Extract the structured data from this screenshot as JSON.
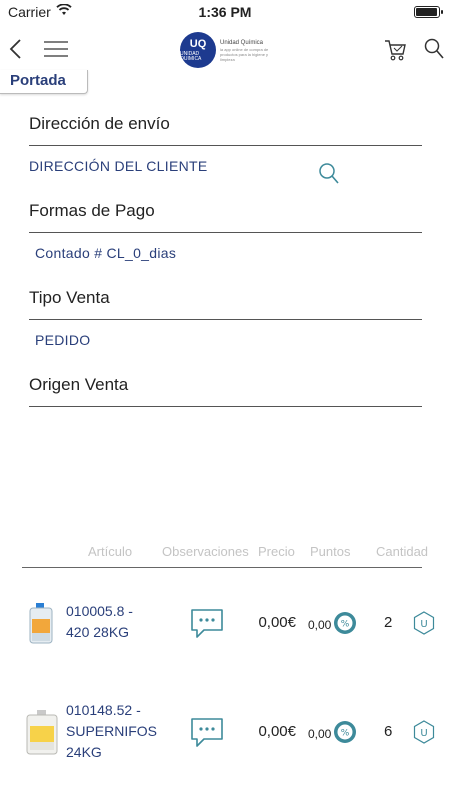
{
  "status": {
    "carrier": "Carrier",
    "time": "1:36 PM"
  },
  "navbar": {
    "logo_mark": "UQ",
    "logo_sub": "UNIDAD QUIMICA",
    "logo_name": "Unidad Química",
    "logo_tag": "la app online de compra de productos para la higiene y limpieza"
  },
  "tab": {
    "label": "Portada"
  },
  "form": {
    "shipping_label": "Dirección de envío",
    "shipping_value": "DIRECCIÓN DEL CLIENTE",
    "payment_label": "Formas de Pago",
    "payment_value": "Contado # CL_0_dias",
    "sale_type_label": "Tipo Venta",
    "sale_type_value": "PEDIDO",
    "origin_label": "Origen Venta"
  },
  "table": {
    "headers": {
      "articulo": "Artículo",
      "observaciones": "Observaciones",
      "precio": "Precio",
      "puntos": "Puntos",
      "cantidad": "Cantidad"
    },
    "rows": [
      {
        "line1": "010005.8 -",
        "line2": "420 28KG",
        "line3": "",
        "price": "0,00€",
        "points": "0,00",
        "qty": "2",
        "unit_icon": "U"
      },
      {
        "line1": "010148.52 -",
        "line2": "SUPERNIFOS",
        "line3": "24KG",
        "price": "0,00€",
        "points": "0,00",
        "qty": "6",
        "unit_icon": "U"
      }
    ]
  },
  "colors": {
    "accent_blue": "#2a3f7a",
    "teal_icon": "#3d8a9a",
    "logo_blue": "#1d3a8f"
  }
}
